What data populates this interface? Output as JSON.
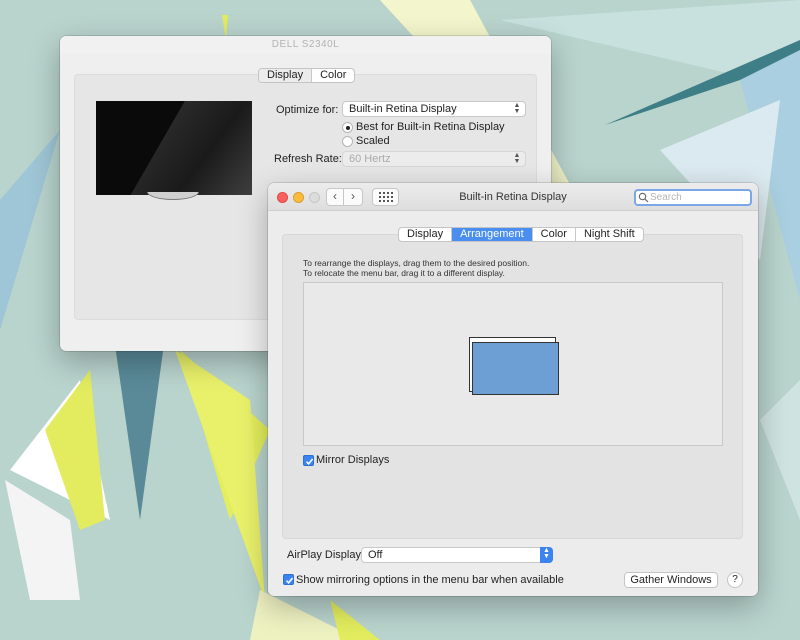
{
  "colors": {
    "accent": "#3a83f1",
    "close": "#fc605c",
    "minimize": "#fdbc40",
    "zoom_disabled": "#dcdcdc",
    "display_fill": "#6e9fd4"
  },
  "dell_window": {
    "title": "DELL S2340L",
    "tabs": [
      {
        "label": "Display",
        "active": true
      },
      {
        "label": "Color",
        "active": false
      }
    ],
    "optimize_label": "Optimize for:",
    "optimize_value": "Built-in Retina Display",
    "radio_best": "Best for Built-in Retina Display",
    "radio_scaled": "Scaled",
    "refresh_label": "Refresh Rate:",
    "refresh_value": "60 Hertz"
  },
  "main_window": {
    "title": "Built-in Retina Display",
    "search": {
      "placeholder": "Search"
    },
    "tabs": [
      {
        "label": "Display",
        "active": false
      },
      {
        "label": "Arrangement",
        "active": true
      },
      {
        "label": "Color",
        "active": false
      },
      {
        "label": "Night Shift",
        "active": false
      }
    ],
    "instructions": [
      "To rearrange the displays, drag them to the desired position.",
      "To relocate the menu bar, drag it to a different display."
    ],
    "mirror_label": "Mirror Displays",
    "mirror_checked": true,
    "airplay_label": "AirPlay Display:",
    "airplay_value": "Off",
    "show_mirroring_label": "Show mirroring options in the menu bar when available",
    "show_mirroring_checked": true,
    "gather_label": "Gather Windows",
    "help_label": "?",
    "icons": {
      "back": "chevron-left-icon",
      "forward": "chevron-right-icon",
      "grid": "grid-icon",
      "search": "magnifier-icon"
    }
  }
}
